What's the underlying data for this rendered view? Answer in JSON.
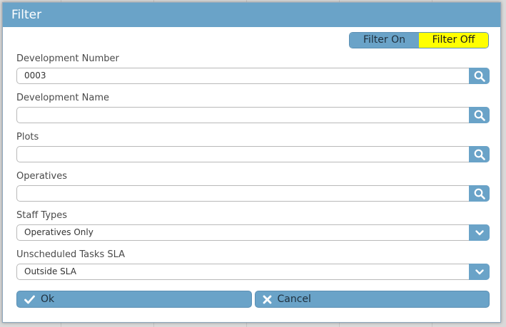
{
  "dialog": {
    "title": "Filter"
  },
  "filter_toggle": {
    "on_label": "Filter On",
    "off_label": "Filter Off",
    "active": "Filter Off"
  },
  "fields": {
    "development_number": {
      "label": "Development Number",
      "value": "0003"
    },
    "development_name": {
      "label": "Development Name",
      "value": ""
    },
    "plots": {
      "label": "Plots",
      "value": ""
    },
    "operatives": {
      "label": "Operatives",
      "value": ""
    },
    "staff_types": {
      "label": "Staff Types",
      "value": "Operatives Only"
    },
    "unscheduled_tasks_sla": {
      "label": "Unscheduled Tasks SLA",
      "value": "Outside SLA"
    }
  },
  "buttons": {
    "ok_label": "Ok",
    "cancel_label": "Cancel"
  },
  "colors": {
    "accent": "#6aa3c8",
    "filter_off_highlight": "#ffff00"
  }
}
